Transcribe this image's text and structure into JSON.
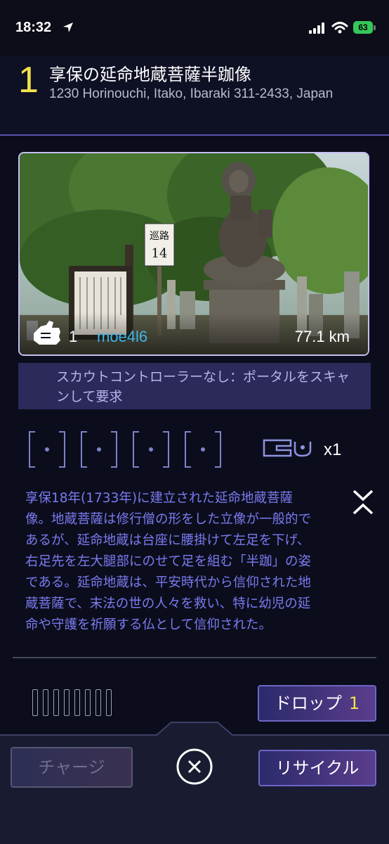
{
  "status_bar": {
    "time": "18:32",
    "battery": "63"
  },
  "portal": {
    "level": "1",
    "name": "享保の延命地蔵菩薩半跏像",
    "address": "1230 Horinouchi, Itako, Ibaraki 311-2433, Japan",
    "owner_level": "1",
    "owner_name": "moe4l6",
    "distance": "77.1 km",
    "scout_notice": "スカウトコントローラーなし：ポータルをスキャンして要求",
    "key_count": "x1",
    "description": "享保18年(1733年)に建立された延命地蔵菩薩像。地蔵菩薩は修行僧の形をした立像が一般的であるが、延命地蔵は台座に腰掛けて左足を下げ、右足先を左大腿部にのせて足を組む「半跏」の姿である。延命地蔵は、平安時代から信仰された地蔵菩薩で、末法の世の人々を救い、特に幼児の延命や守護を祈願する仏として信仰された。",
    "photo_sign_text": "巡路 14"
  },
  "actions": {
    "drop_label": "ドロップ",
    "drop_count": "1",
    "charge_label": "チャージ",
    "recycle_label": "リサイクル"
  },
  "mod_slots": [
    "empty",
    "empty",
    "empty",
    "empty"
  ],
  "resonator_slots": 8,
  "colors": {
    "level_yellow": "#f2e24a",
    "owner_blue": "#3fb6e8",
    "description_purple": "#7b7af0",
    "accent_purple": "#6d66c8"
  },
  "icons": [
    "location-arrow-icon",
    "signal-icon",
    "wifi-icon",
    "battery-icon",
    "hand-icon",
    "key-icon",
    "collapse-icon",
    "close-icon"
  ]
}
